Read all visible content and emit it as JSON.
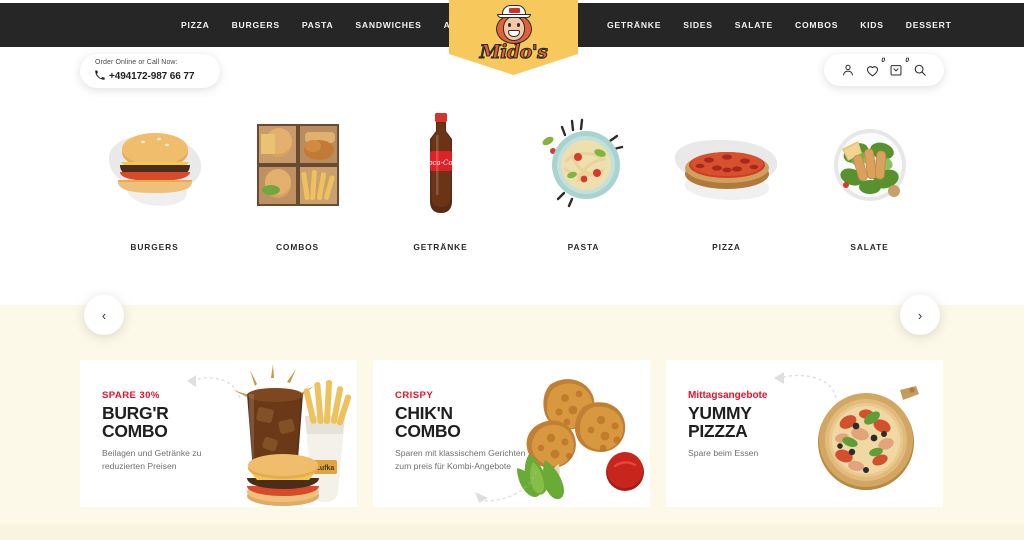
{
  "site": {
    "brand_name": "Mido's",
    "brand_yellow": "#f7c95c",
    "accent_red": "#e8112d",
    "nav_bg": "#262626",
    "promo_band_bg": "#fdf9e9"
  },
  "nav": {
    "left_items": [
      {
        "label": "PIZZA"
      },
      {
        "label": "BURGERS"
      },
      {
        "label": "PASTA"
      },
      {
        "label": "SANDWICHES"
      },
      {
        "label": "ANGEBOTE"
      }
    ],
    "right_items": [
      {
        "label": "GETRÄNKE"
      },
      {
        "label": "SIDES"
      },
      {
        "label": "SALATE"
      },
      {
        "label": "COMBOS"
      },
      {
        "label": "KIDS"
      },
      {
        "label": "DESSERT"
      }
    ]
  },
  "contact": {
    "caption": "Order Online or Call Now:",
    "phone": "+494172-987 66 77",
    "phone_icon": "phone-icon"
  },
  "utility_icons": [
    {
      "name": "account-icon",
      "badge": null
    },
    {
      "name": "wishlist-heart-icon",
      "badge": "0"
    },
    {
      "name": "cart-bag-icon",
      "badge": "0"
    },
    {
      "name": "search-icon",
      "badge": null
    }
  ],
  "carousel": {
    "prev_label": "‹",
    "next_label": "›",
    "categories": [
      {
        "label": "BURGERS",
        "image": "cheeseburger"
      },
      {
        "label": "COMBOS",
        "image": "combo-box"
      },
      {
        "label": "GETRÄNKE",
        "image": "cola-bottle"
      },
      {
        "label": "PASTA",
        "image": "pasta-plate"
      },
      {
        "label": "PIZZA",
        "image": "pepperoni-pizza"
      },
      {
        "label": "SALATE",
        "image": "chicken-salad"
      }
    ]
  },
  "promos": [
    {
      "kicker": "SPARE 30%",
      "title_line1": "BURG'R",
      "title_line2": "COMBO",
      "subtitle": "Beilagen und Getränke zu reduzierten Preisen",
      "image": "burger-fries-drink"
    },
    {
      "kicker": "CRISPY",
      "title_line1": "CHIK'N",
      "title_line2": "COMBO",
      "subtitle": "Sparen mit klassischem Gerichten zum preis für Kombi-Angebote",
      "image": "fried-chicken-ketchup"
    },
    {
      "kicker": "Mittagsangebote",
      "title_line1": "YUMMY",
      "title_line2": "PIZZZA",
      "subtitle": "Spare beim Essen",
      "image": "pizza-on-board"
    }
  ]
}
